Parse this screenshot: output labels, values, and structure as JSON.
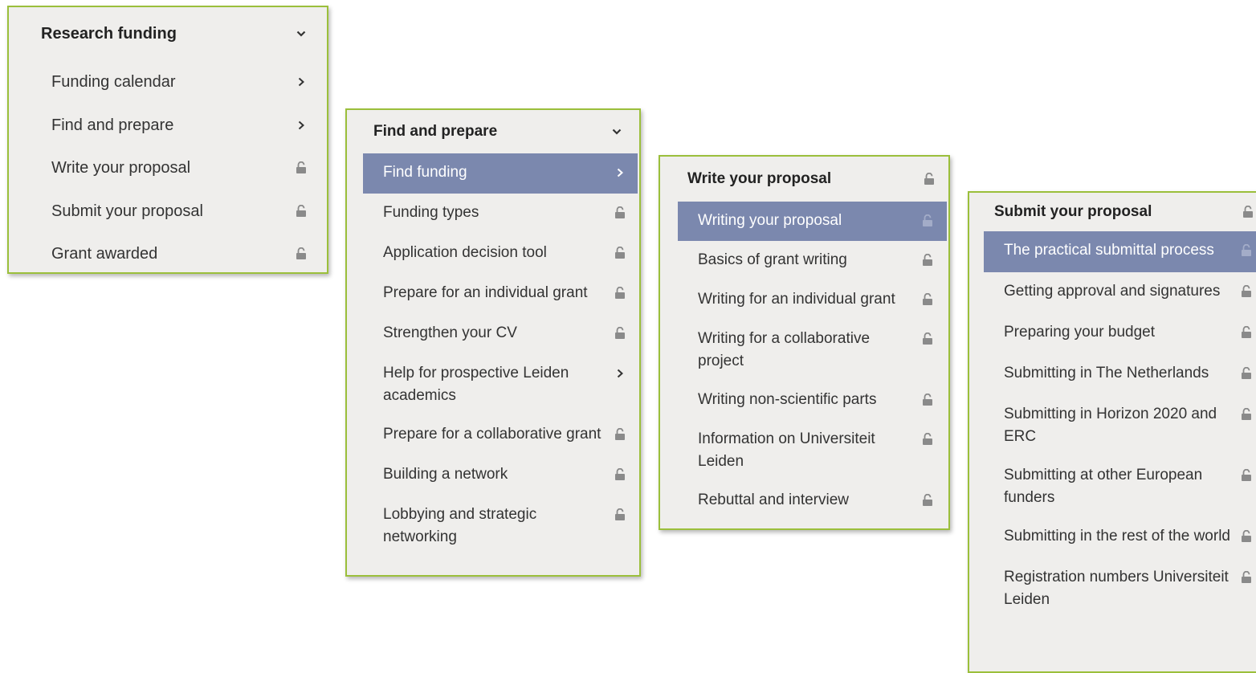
{
  "panels": [
    {
      "title": "Research funding",
      "title_icon": "chevron-down-icon",
      "items": [
        {
          "label": "Funding calendar",
          "icon": "chevron-right-icon"
        },
        {
          "label": "Find and prepare",
          "icon": "chevron-right-icon"
        },
        {
          "label": "Write your proposal",
          "icon": "lock-icon"
        },
        {
          "label": "Submit your proposal",
          "icon": "lock-icon"
        },
        {
          "label": "Grant awarded",
          "icon": "lock-icon"
        }
      ]
    },
    {
      "title": "Find and prepare",
      "title_icon": "chevron-down-icon",
      "items": [
        {
          "label": "Find funding",
          "icon": "chevron-right-icon",
          "active": true
        },
        {
          "label": "Funding types",
          "icon": "lock-icon"
        },
        {
          "label": "Application decision tool",
          "icon": "lock-icon"
        },
        {
          "label": "Prepare for an individual grant",
          "icon": "lock-icon"
        },
        {
          "label": "Strengthen your CV",
          "icon": "lock-icon"
        },
        {
          "label": "Help for prospective Leiden academics",
          "icon": "chevron-right-icon"
        },
        {
          "label": "Prepare for a collaborative grant",
          "icon": "lock-icon"
        },
        {
          "label": "Building a network",
          "icon": "lock-icon"
        },
        {
          "label": "Lobbying and strategic networking",
          "icon": "lock-icon"
        }
      ]
    },
    {
      "title": "Write your proposal",
      "title_icon": "lock-icon",
      "items": [
        {
          "label": "Writing your proposal",
          "icon": "lock-icon",
          "active": true
        },
        {
          "label": "Basics of grant writing",
          "icon": "lock-icon"
        },
        {
          "label": "Writing for an individual grant",
          "icon": "lock-icon"
        },
        {
          "label": "Writing for a collaborative project",
          "icon": "lock-icon"
        },
        {
          "label": "Writing non-scientific parts",
          "icon": "lock-icon"
        },
        {
          "label": "Information on Universiteit Leiden",
          "icon": "lock-icon"
        },
        {
          "label": "Rebuttal and interview",
          "icon": "lock-icon"
        }
      ]
    },
    {
      "title": "Submit your proposal",
      "title_icon": "lock-icon",
      "items": [
        {
          "label": "The practical submittal process",
          "icon": "lock-icon",
          "active": true
        },
        {
          "label": "Getting approval and signatures",
          "icon": "lock-icon"
        },
        {
          "label": "Preparing your budget",
          "icon": "lock-icon"
        },
        {
          "label": "Submitting in The Netherlands",
          "icon": "lock-icon"
        },
        {
          "label": "Submitting in Horizon 2020 and ERC",
          "icon": "lock-icon"
        },
        {
          "label": "Submitting at other European funders",
          "icon": "lock-icon"
        },
        {
          "label": "Submitting in the rest of the world",
          "icon": "lock-icon"
        },
        {
          "label": "Registration numbers Universiteit Leiden",
          "icon": "lock-icon"
        }
      ]
    }
  ],
  "colors": {
    "panel_bg": "#efeeec",
    "border": "#9bbf3b",
    "active_bg": "#7b88ae",
    "text": "#333333",
    "icon": "#8a8a8a"
  }
}
